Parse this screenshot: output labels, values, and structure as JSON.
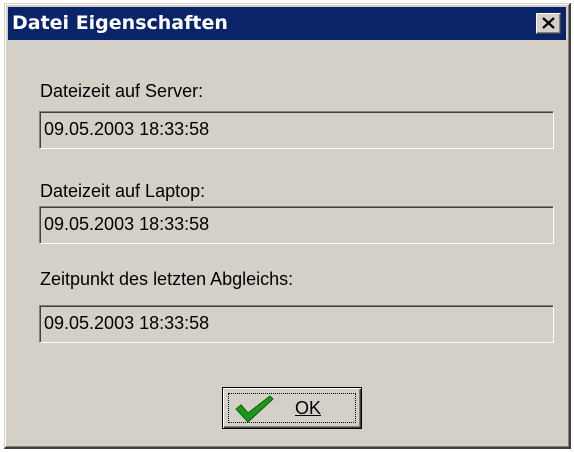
{
  "dialog": {
    "title": "Datei Eigenschaften",
    "close_icon": "close-icon"
  },
  "fields": {
    "server_label": "Dateizeit auf Server:",
    "server_value": "09.05.2003 18:33:58",
    "laptop_label": "Dateizeit auf Laptop:",
    "laptop_value": "09.05.2003 18:33:58",
    "sync_label": "Zeitpunkt des letzten Abgleichs:",
    "sync_value": "09.05.2003 18:33:58"
  },
  "buttons": {
    "ok_label": "OK",
    "ok_icon": "checkmark-icon"
  },
  "colors": {
    "titlebar": "#0a246a",
    "face": "#d4d0c8",
    "check_green": "#1a9a1a"
  }
}
